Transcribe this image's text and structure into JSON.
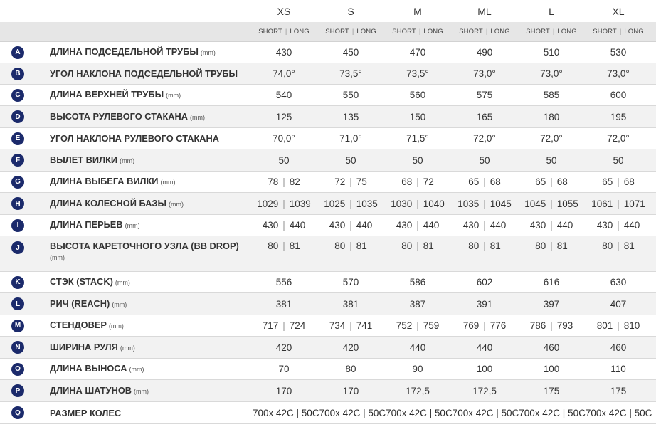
{
  "sizes": [
    "XS",
    "S",
    "M",
    "ML",
    "L",
    "XL"
  ],
  "sub_short": "SHORT",
  "sub_long": "LONG",
  "sep": "|",
  "rows": [
    {
      "letter": "A",
      "name": "ДЛИНА ПОДСЕДЕЛЬНОЙ ТРУБЫ",
      "unit": "(mm)",
      "values": [
        "430",
        "450",
        "470",
        "490",
        "510",
        "530"
      ]
    },
    {
      "letter": "B",
      "name": "УГОЛ НАКЛОНА ПОДСЕДЕЛЬНОЙ ТРУБЫ",
      "unit": "",
      "values": [
        "74,0°",
        "73,5°",
        "73,5°",
        "73,0°",
        "73,0°",
        "73,0°"
      ]
    },
    {
      "letter": "C",
      "name": "ДЛИНА ВЕРХНЕЙ ТРУБЫ",
      "unit": "(mm)",
      "values": [
        "540",
        "550",
        "560",
        "575",
        "585",
        "600"
      ]
    },
    {
      "letter": "D",
      "name": "ВЫСОТА РУЛЕВОГО СТАКАНА",
      "unit": "(mm)",
      "values": [
        "125",
        "135",
        "150",
        "165",
        "180",
        "195"
      ]
    },
    {
      "letter": "E",
      "name": "УГОЛ НАКЛОНА РУЛЕВОГО СТАКАНА",
      "unit": "",
      "values": [
        "70,0°",
        "71,0°",
        "71,5°",
        "72,0°",
        "72,0°",
        "72,0°"
      ]
    },
    {
      "letter": "F",
      "name": "ВЫЛЕТ ВИЛКИ",
      "unit": "(mm)",
      "values": [
        "50",
        "50",
        "50",
        "50",
        "50",
        "50"
      ]
    },
    {
      "letter": "G",
      "name": "ДЛИНА ВЫБЕГА ВИЛКИ",
      "unit": "(mm)",
      "pairs": [
        [
          "78",
          "82"
        ],
        [
          "72",
          "75"
        ],
        [
          "68",
          "72"
        ],
        [
          "65",
          "68"
        ],
        [
          "65",
          "68"
        ],
        [
          "65",
          "68"
        ]
      ]
    },
    {
      "letter": "H",
      "name": "ДЛИНА КОЛЕСНОЙ БАЗЫ",
      "unit": "(mm)",
      "pairs": [
        [
          "1029",
          "1039"
        ],
        [
          "1025",
          "1035"
        ],
        [
          "1030",
          "1040"
        ],
        [
          "1035",
          "1045"
        ],
        [
          "1045",
          "1055"
        ],
        [
          "1061",
          "1071"
        ]
      ]
    },
    {
      "letter": "I",
      "name": "ДЛИНА ПЕРЬЕВ",
      "unit": "(mm)",
      "pairs": [
        [
          "430",
          "440"
        ],
        [
          "430",
          "440"
        ],
        [
          "430",
          "440"
        ],
        [
          "430",
          "440"
        ],
        [
          "430",
          "440"
        ],
        [
          "430",
          "440"
        ]
      ]
    },
    {
      "letter": "J",
      "name": "ВЫСОТА КАРЕТОЧНОГО УЗЛА (BB DROP)",
      "unit": "(mm)",
      "pairs": [
        [
          "80",
          "81"
        ],
        [
          "80",
          "81"
        ],
        [
          "80",
          "81"
        ],
        [
          "80",
          "81"
        ],
        [
          "80",
          "81"
        ],
        [
          "80",
          "81"
        ]
      ]
    },
    {
      "letter": "K",
      "name": "СТЭК (STACK)",
      "unit": "(mm)",
      "values": [
        "556",
        "570",
        "586",
        "602",
        "616",
        "630"
      ]
    },
    {
      "letter": "L",
      "name": "РИЧ (REACH)",
      "unit": "(mm)",
      "values": [
        "381",
        "381",
        "387",
        "391",
        "397",
        "407"
      ]
    },
    {
      "letter": "M",
      "name": "СТЕНДОВЕР",
      "unit": "(mm)",
      "pairs": [
        [
          "717",
          "724"
        ],
        [
          "734",
          "741"
        ],
        [
          "752",
          "759"
        ],
        [
          "769",
          "776"
        ],
        [
          "786",
          "793"
        ],
        [
          "801",
          "810"
        ]
      ]
    },
    {
      "letter": "N",
      "name": "ШИРИНА РУЛЯ",
      "unit": "(mm)",
      "values": [
        "420",
        "420",
        "440",
        "440",
        "460",
        "460"
      ]
    },
    {
      "letter": "O",
      "name": "ДЛИНА ВЫНОСА",
      "unit": "(mm)",
      "values": [
        "70",
        "80",
        "90",
        "100",
        "100",
        "110"
      ]
    },
    {
      "letter": "P",
      "name": "ДЛИНА ШАТУНОВ",
      "unit": "(mm)",
      "values": [
        "170",
        "170",
        "172,5",
        "172,5",
        "175",
        "175"
      ]
    },
    {
      "letter": "Q",
      "name": "РАЗМЕР КОЛЕС",
      "unit": "",
      "wheel": "700x 42C | 50C700x 42C | 50C700x 42C | 50C700x 42C | 50C700x 42C | 50C700x 42C | 50C"
    }
  ],
  "colors": {
    "badge": "#1b2a6b",
    "row_alt": "#f2f2f2",
    "subheader": "#e6e6e6"
  }
}
